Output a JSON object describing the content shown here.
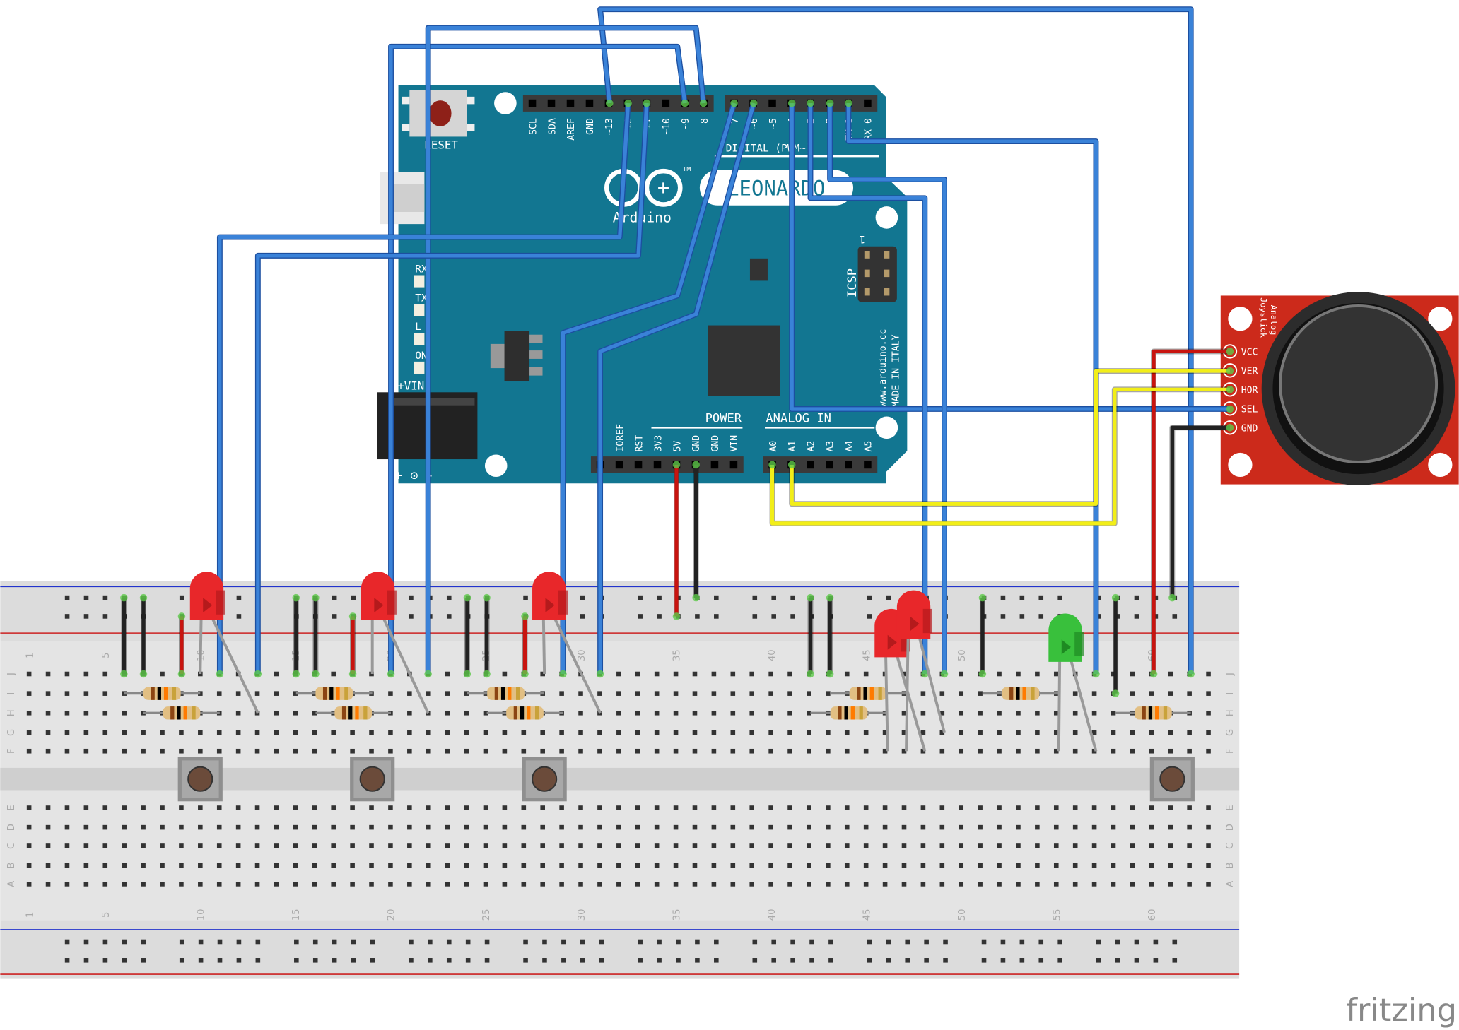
{
  "arduino": {
    "reset_label": "RESET",
    "digital_header_left": [
      "SCL",
      "SDA",
      "AREF",
      "GND",
      "~13",
      "12",
      "~11",
      "~10",
      "~9",
      "8"
    ],
    "digital_header_right": [
      "7",
      "~6",
      "~5",
      "4",
      "~3",
      "2",
      "TX 1",
      "RX 0"
    ],
    "digital_label": "DIGITAL (PWM~)",
    "logo_text": "Arduino",
    "model": "LEONARDO",
    "tm": "TM",
    "icsp_label": "ICSP",
    "icsp_pin1": "1",
    "leds": [
      "RX",
      "TX",
      "L",
      "ON"
    ],
    "vin_label": "+VIN",
    "power_label": "POWER",
    "power_pins": [
      "IOREF",
      "RST",
      "3V3",
      "5V",
      "GND",
      "GND",
      "VIN"
    ],
    "analog_label": "ANALOG IN",
    "analog_pins": [
      "A0",
      "A1",
      "A2",
      "A3",
      "A4",
      "A5"
    ],
    "website": "www.arduino.cc",
    "made_in": "MADE IN ITALY",
    "polarity": "+ ⊙ -"
  },
  "joystick": {
    "title_line1": "Analog",
    "title_line2": "Joystick",
    "pins": [
      "VCC",
      "VER",
      "HOR",
      "SEL",
      "GND"
    ]
  },
  "breadboard": {
    "column_numbers": [
      "1",
      "5",
      "10",
      "15",
      "20",
      "25",
      "30",
      "35",
      "40",
      "45",
      "50",
      "55",
      "60"
    ],
    "rows_top": [
      "J",
      "I",
      "H",
      "G",
      "F"
    ],
    "rows_bottom": [
      "E",
      "D",
      "C",
      "B",
      "A"
    ]
  },
  "components": {
    "leds": [
      {
        "color": "red"
      },
      {
        "color": "red"
      },
      {
        "color": "red"
      },
      {
        "color": "red"
      },
      {
        "color": "red"
      },
      {
        "color": "green"
      }
    ],
    "pushbuttons": 4,
    "resistors": 10
  },
  "colors": {
    "board_teal": "#127691",
    "wire_blue": "#3a82d8",
    "wire_red": "#c8140f",
    "wire_black": "#222222",
    "wire_yellow": "#f2ee18",
    "joystick_red": "#cc2a1b",
    "breadboard": "#dcdcdc"
  },
  "watermark": "fritzing"
}
